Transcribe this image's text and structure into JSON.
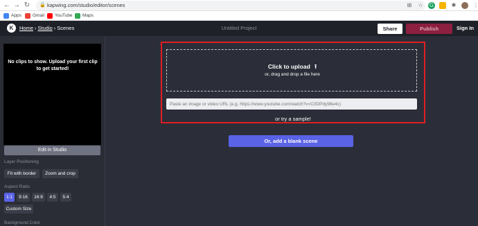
{
  "browser": {
    "url": "kapwing.com/studio/editor/scenes",
    "bookmarks": [
      {
        "label": "Apps",
        "color": "#4285f4"
      },
      {
        "label": "Gmail",
        "color": "#ea4335"
      },
      {
        "label": "YouTube",
        "color": "#ff0000"
      },
      {
        "label": "Maps",
        "color": "#34a853"
      }
    ]
  },
  "appbar": {
    "logo": "K",
    "crumb_home": "Home",
    "sep1": "›",
    "crumb_studio": "Studio",
    "sep2": "›",
    "crumb_scenes": "Scenes",
    "project_title": "Untitled Project",
    "share": "Share",
    "publish": "Publish",
    "signin": "Sign In"
  },
  "sidebar": {
    "preview_text": "No clips to show. Upload your first clip to get started!",
    "edit_in_studio": "Edit in Studio",
    "layer_positioning_label": "Layer Positioning",
    "layer_options": [
      "Fit with border",
      "Zoom and crop"
    ],
    "aspect_ratio_label": "Aspect Ratio",
    "aspect_options": [
      "1:1",
      "9:16",
      "16:9",
      "4:5",
      "5:4"
    ],
    "aspect_selected": "1:1",
    "custom_size": "Custom Size",
    "background_color_label": "Background Color"
  },
  "upload": {
    "click_to_upload": "Click to upload",
    "drag_drop": "or, drag and drop a file here",
    "url_placeholder": "Paste an image or video URL (e.g. https://www.youtube.com/watch?v=C0DPdy98e4c)",
    "try_sample": "or try a sample!",
    "blank_scene": "Or, add a blank scene"
  },
  "colors": {
    "accent": "#5a62e6",
    "publish": "#8c1f3f",
    "highlight_border": "#e21d24"
  }
}
